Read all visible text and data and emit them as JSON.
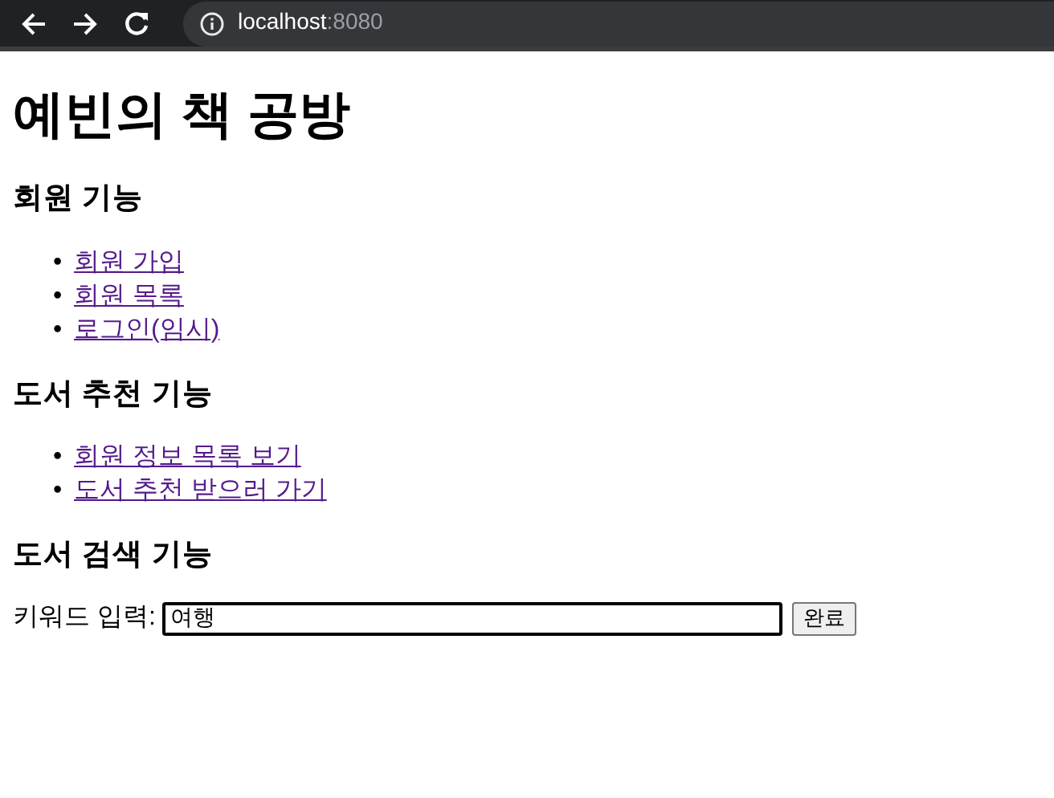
{
  "browser": {
    "url_host": "localhost",
    "url_port": ":8080"
  },
  "title": "예빈의 책 공방",
  "sections": [
    {
      "heading": "회원 기능",
      "links": [
        {
          "bullet": "•",
          "label": "회원 가입",
          "visited": true
        },
        {
          "bullet": "•",
          "label": "회원 목록",
          "visited": true
        },
        {
          "bullet": "•",
          "label": "로그인(임시)",
          "visited": true
        }
      ]
    },
    {
      "heading": "도서 추천 기능",
      "links": [
        {
          "bullet": "•",
          "label": "회원 정보 목록 보기",
          "visited": true
        },
        {
          "bullet": "•",
          "label": "도서 추천 받으러 가기",
          "visited": true
        }
      ]
    },
    {
      "heading": "도서 검색 기능"
    }
  ],
  "search": {
    "label": "키워드 입력:",
    "value": "여행",
    "focused": true,
    "button": "완료"
  }
}
